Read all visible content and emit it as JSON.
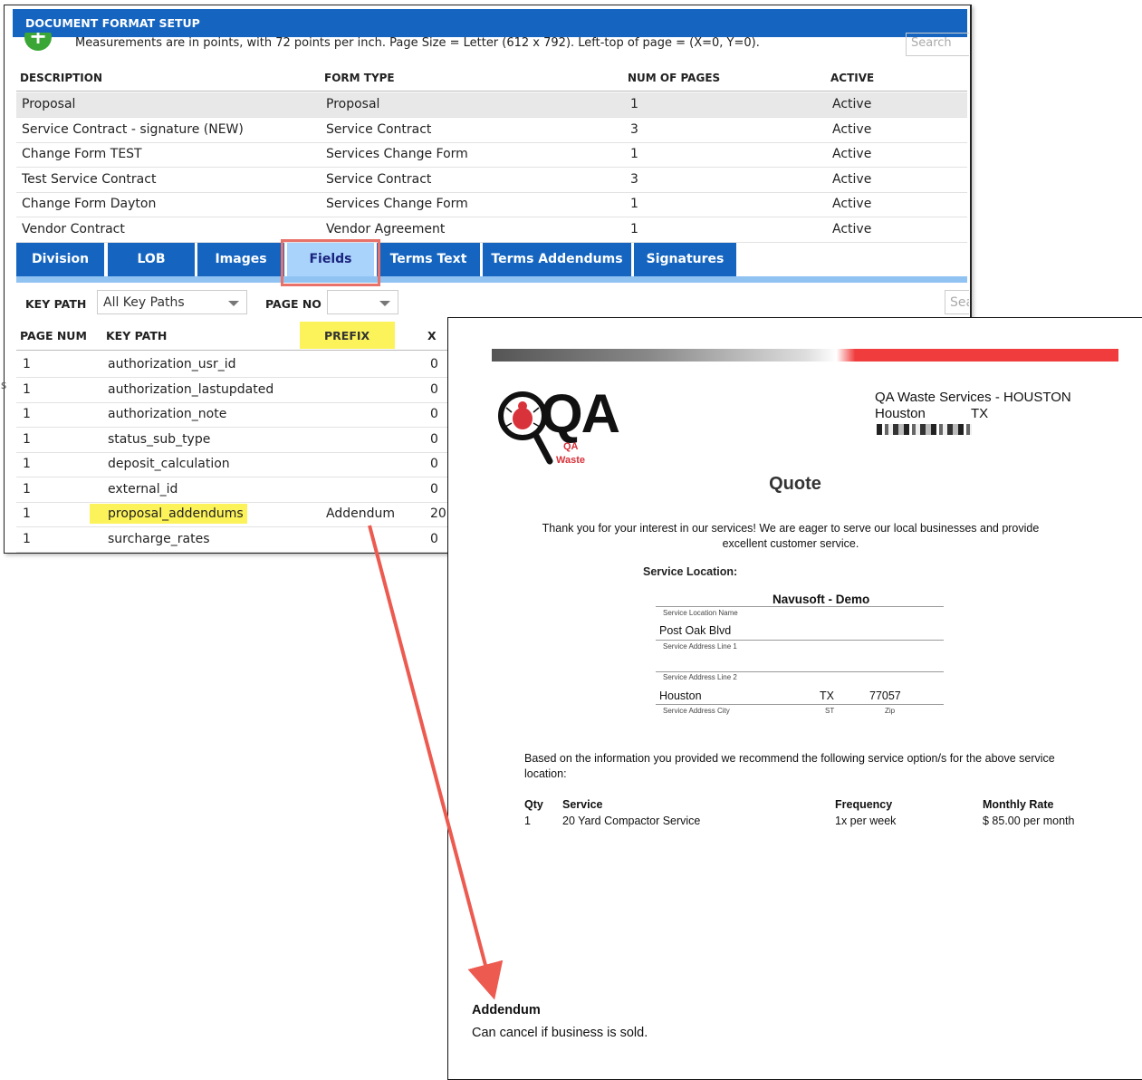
{
  "setup": {
    "title": "DOCUMENT FORMAT SETUP",
    "add_icon": "+",
    "measurement_note": "Measurements are in points, with 72 points per inch. Page Size = Letter (612 x 792). Left-top of page = (X=0, Y=0).",
    "search_placeholder": "Search",
    "columns": {
      "description": "DESCRIPTION",
      "form_type": "FORM TYPE",
      "num_pages": "NUM OF PAGES",
      "active": "ACTIVE"
    },
    "rows": [
      {
        "description": "Proposal",
        "form_type": "Proposal",
        "num_pages": "1",
        "active": "Active"
      },
      {
        "description": "Service Contract - signature (NEW)",
        "form_type": "Service Contract",
        "num_pages": "3",
        "active": "Active"
      },
      {
        "description": "Change Form TEST",
        "form_type": "Services Change Form",
        "num_pages": "1",
        "active": "Active"
      },
      {
        "description": "Test Service Contract",
        "form_type": "Service Contract",
        "num_pages": "3",
        "active": "Active"
      },
      {
        "description": "Change Form Dayton",
        "form_type": "Services Change Form",
        "num_pages": "1",
        "active": "Active"
      },
      {
        "description": "Vendor Contract",
        "form_type": "Vendor Agreement",
        "num_pages": "1",
        "active": "Active"
      }
    ],
    "tabs": [
      "Division",
      "LOB",
      "Images",
      "Fields",
      "Terms Text",
      "Terms Addendums",
      "Signatures"
    ],
    "active_tab": "Fields",
    "filters": {
      "key_path_label": "KEY PATH",
      "key_path_value": "All Key Paths",
      "page_no_label": "PAGE NO",
      "page_no_value": "",
      "search_placeholder": "Search"
    },
    "field_columns": {
      "page_num": "PAGE NUM",
      "key_path": "KEY PATH",
      "prefix": "PREFIX",
      "x": "X"
    },
    "field_rows": [
      {
        "page_num": "1",
        "key_path": "authorization_usr_id",
        "prefix": "",
        "x": "0"
      },
      {
        "page_num": "1",
        "key_path": "authorization_lastupdated",
        "prefix": "",
        "x": "0"
      },
      {
        "page_num": "1",
        "key_path": "authorization_note",
        "prefix": "",
        "x": "0"
      },
      {
        "page_num": "1",
        "key_path": "status_sub_type",
        "prefix": "",
        "x": "0"
      },
      {
        "page_num": "1",
        "key_path": "deposit_calculation",
        "prefix": "",
        "x": "0"
      },
      {
        "page_num": "1",
        "key_path": "external_id",
        "prefix": "",
        "x": "0"
      },
      {
        "page_num": "1",
        "key_path": "proposal_addendums",
        "prefix": "Addendum",
        "x": "20"
      },
      {
        "page_num": "1",
        "key_path": "surcharge_rates",
        "prefix": "",
        "x": "0"
      }
    ],
    "highlight_color": "#fcf35a",
    "tab_color": "#1565c0"
  },
  "quote": {
    "logo": {
      "letters": "QA",
      "caption_1": "QA",
      "caption_2": "Waste"
    },
    "company": "QA Waste Services - HOUSTON",
    "city": "Houston",
    "state": "TX",
    "title": "Quote",
    "intro": "Thank you for your interest in our services! We are eager to serve our local businesses and provide excellent customer service.",
    "location_heading": "Service Location:",
    "location_name": "Navusoft - Demo",
    "location_name_label": "Service Location Name",
    "address_line1": "Post Oak Blvd",
    "address_line1_label": "Service Address Line 1",
    "address_line2": "",
    "address_line2_label": "Service Address Line 2",
    "address_city": "Houston",
    "address_state": "TX",
    "address_zip": "77057",
    "city_label": "Service Address City",
    "st_label": "ST",
    "zip_label": "Zip",
    "recommend_text": "Based on the information you provided we recommend the following service option/s for the above service location:",
    "service_columns": {
      "qty": "Qty",
      "service": "Service",
      "frequency": "Frequency",
      "rate": "Monthly Rate"
    },
    "services": [
      {
        "qty": "1",
        "service": "20 Yard Compactor Service",
        "frequency": "1x per week",
        "rate": "$ 85.00 per month"
      }
    ],
    "addendum_title": "Addendum",
    "addendum_text": "Can cancel if business is sold.",
    "accent_color": "#f03c3c"
  }
}
